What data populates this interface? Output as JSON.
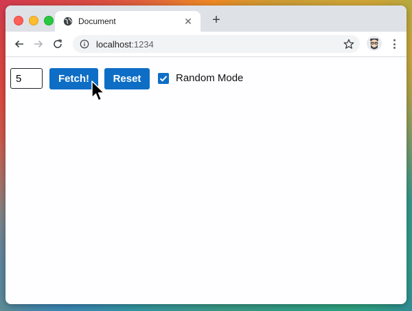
{
  "browser": {
    "tab_title": "Document",
    "new_tab_symbol": "+",
    "close_symbol": "✕",
    "url_host": "localhost",
    "url_port": ":1234",
    "icons": {
      "tab": "globe-icon",
      "back": "back-arrow-icon",
      "forward": "forward-arrow-icon",
      "reload": "reload-icon",
      "site_info": "info-icon",
      "bookmark": "star-icon",
      "profile": "avatar-icon",
      "menu": "kebab-menu-icon"
    }
  },
  "form": {
    "count_value": "5",
    "fetch_label": "Fetch!",
    "reset_label": "Reset",
    "random_mode_label": "Random Mode",
    "random_mode_checked": true
  },
  "colors": {
    "accent": "#0e6ec6",
    "tabbar": "#dee1e6",
    "page_bg": "#fefdff"
  }
}
